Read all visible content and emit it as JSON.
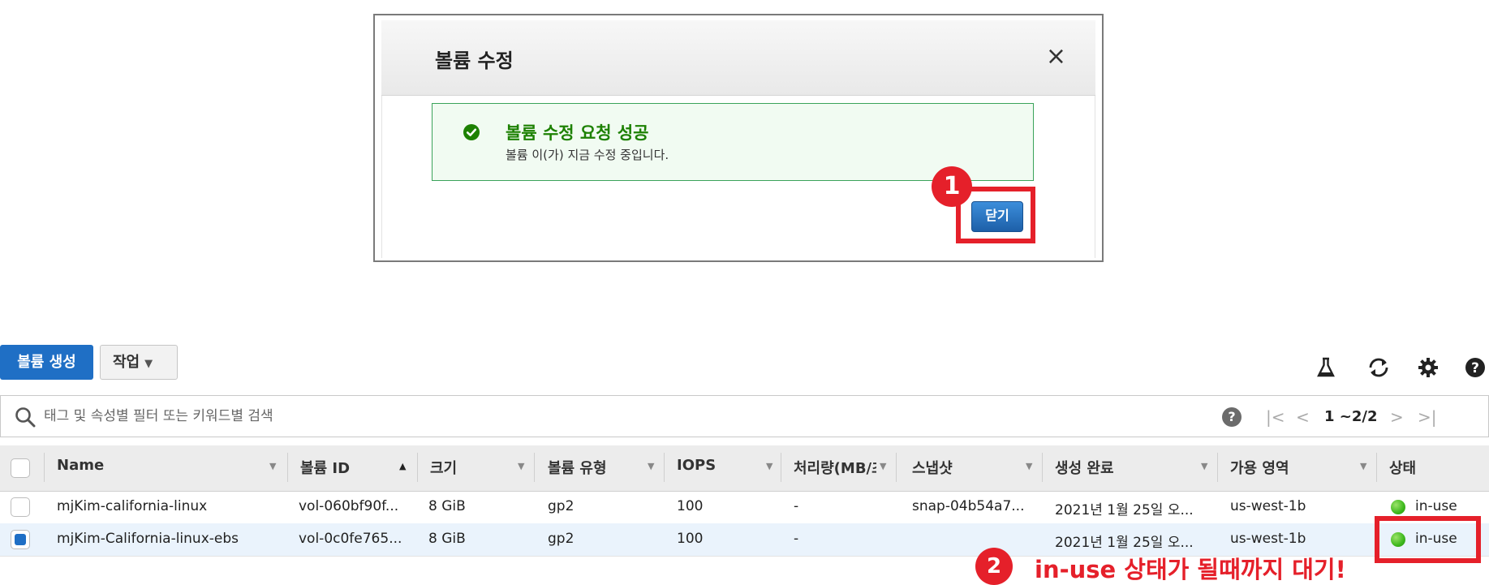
{
  "modal": {
    "title": "볼륨 수정",
    "close_symbol": "×",
    "success_title": "볼륨 수정 요청 성공",
    "success_message": "볼륨 이(가) 지금 수정 중입니다.",
    "close_button_label": "닫기"
  },
  "annotations": {
    "step1": "1",
    "step2": "2",
    "step2_text": "in-use 상태가 될때까지 대기!",
    "highlight_color": "#e5202a"
  },
  "toolbar": {
    "create_label": "볼륨 생성",
    "actions_label": "작업",
    "icons": [
      "flask-icon",
      "refresh-icon",
      "gear-icon",
      "help-icon"
    ]
  },
  "filter": {
    "placeholder": "태그 및 속성별 필터 또는 키워드별 검색",
    "pagination": "1 ~2/2"
  },
  "table": {
    "columns": [
      "Name",
      "볼륨 ID",
      "크기",
      "볼륨 유형",
      "IOPS",
      "처리량(MB/초)",
      "스냅샷",
      "생성 완료",
      "가용 영역",
      "상태"
    ],
    "rows": [
      {
        "name": "mjKim-california-linux",
        "volume_id": "vol-060bf90f...",
        "size": "8 GiB",
        "type": "gp2",
        "iops": "100",
        "throughput": "-",
        "snapshot": "snap-04b54a7...",
        "created": "2021년 1월 25일 오...",
        "az": "us-west-1b",
        "state": "in-use",
        "selected": false
      },
      {
        "name": "mjKim-California-linux-ebs",
        "volume_id": "vol-0c0fe765...",
        "size": "8 GiB",
        "type": "gp2",
        "iops": "100",
        "throughput": "-",
        "snapshot": "",
        "created": "2021년 1월 25일 오...",
        "az": "us-west-1b",
        "state": "in-use",
        "selected": true
      }
    ]
  },
  "colors": {
    "primary_button": "#1f6fc5",
    "success_green": "#1d8102",
    "status_green": "#3db81c"
  }
}
